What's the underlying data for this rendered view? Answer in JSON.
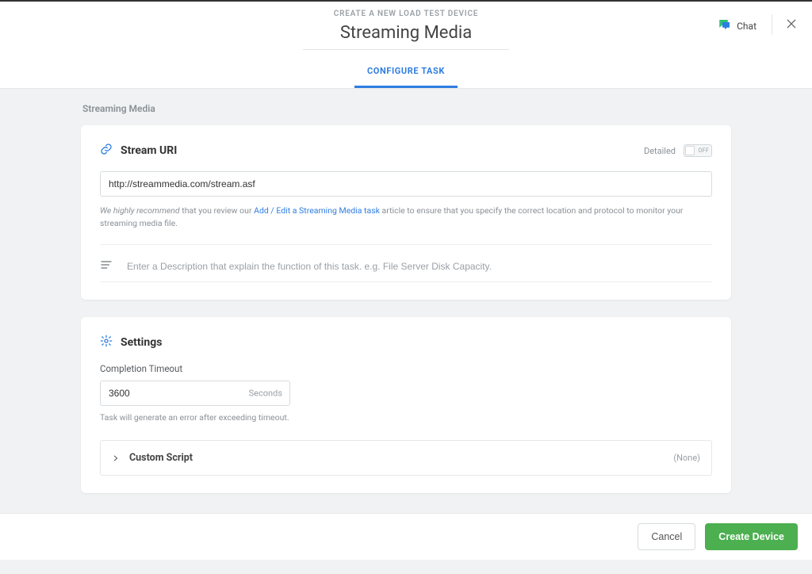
{
  "header": {
    "super_title": "CREATE A NEW LOAD TEST DEVICE",
    "title": "Streaming Media",
    "chat_label": "Chat"
  },
  "tabs": {
    "configure": "CONFIGURE TASK"
  },
  "breadcrumb": "Streaming Media",
  "stream_uri": {
    "title": "Stream URI",
    "detailed_label": "Detailed",
    "toggle_state": "OFF",
    "value": "http://streammedia.com/stream.asf",
    "hint_prefix_italic": "We highly recommend",
    "hint_mid": " that you review our ",
    "hint_link": "Add / Edit a Streaming Media task",
    "hint_suffix": " article to ensure that you specify the correct location and protocol to monitor your streaming media file.",
    "description_placeholder": "Enter a Description that explain the function of this task. e.g. File Server Disk Capacity."
  },
  "settings": {
    "title": "Settings",
    "timeout_label": "Completion Timeout",
    "timeout_value": "3600",
    "timeout_unit": "Seconds",
    "timeout_help": "Task will generate an error after exceeding timeout.",
    "custom_script_title": "Custom Script",
    "custom_script_status": "(None)"
  },
  "footer": {
    "cancel": "Cancel",
    "create": "Create Device"
  }
}
